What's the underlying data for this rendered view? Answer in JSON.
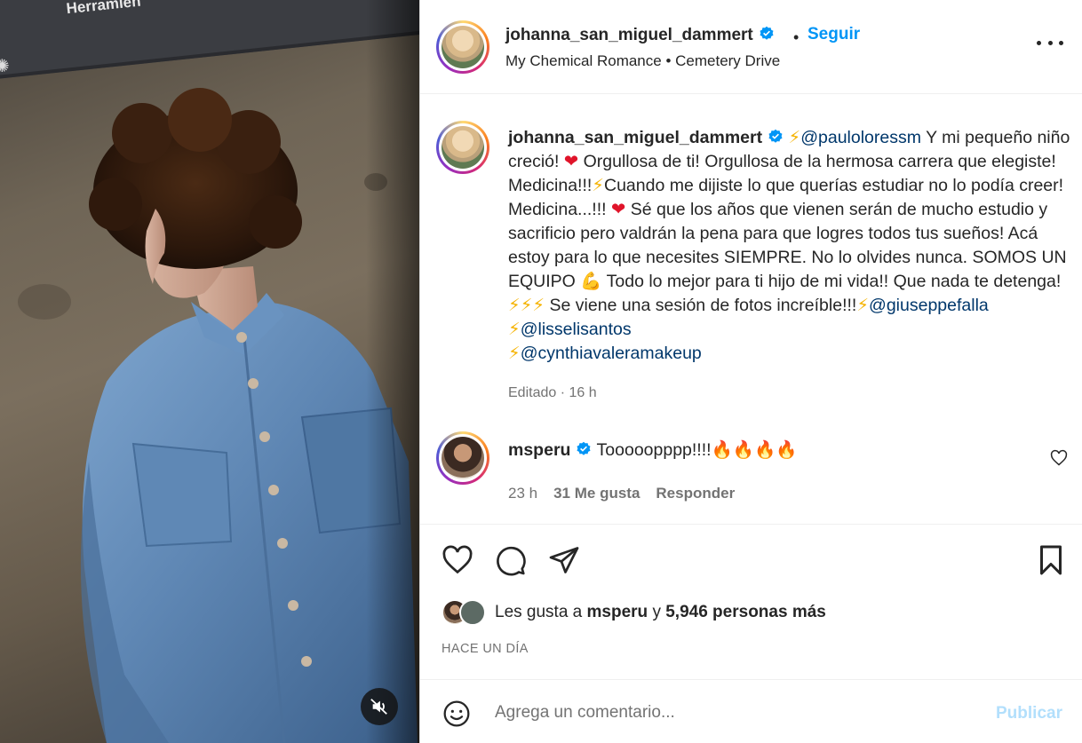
{
  "media": {
    "screen_tab_text": "Herramien",
    "mute_icon": "speaker-muted-icon"
  },
  "header": {
    "username": "johanna_san_miguel_dammert",
    "separator": "•",
    "follow_label": "Seguir",
    "song": "My Chemical Romance • Cemetery Drive"
  },
  "caption": {
    "username": "johanna_san_miguel_dammert",
    "mention_1": "@pauloloressm",
    "text_1": " Y mi pequeño niño creció! ",
    "text_2": " Orgullosa de ti! Orgullosa de la hermosa carrera que elegiste! Medicina!!!",
    "text_3": "Cuando me dijiste lo que querías estudiar no lo podía creer! Medicina...!!! ",
    "text_4": "  Sé que los años que vienen serán de mucho estudio y sacrificio pero valdrán la pena para que logres todos tus sueños! Acá estoy para lo que necesites SIEMPRE. No lo olvides nunca. SOMOS UN EQUIPO ",
    "text_5": " Todo lo mejor para ti hijo de mi vida!! Que nada te detenga! ",
    "text_6": " Se viene una sesión de fotos increíble!!!",
    "mention_2": "@giuseppefalla",
    "mention_3": "@lisselisantos",
    "mention_4": "@cynthiavaleramakeup",
    "emoji_bolt": "⚡",
    "emoji_heart": "❤",
    "emoji_muscle": "💪",
    "meta": "Editado · 16 h"
  },
  "comment": {
    "username": "msperu",
    "text": "Tooooopppp!!!!🔥🔥🔥🔥",
    "time": "23 h",
    "likes": "31 Me gusta",
    "reply": "Responder"
  },
  "likes": {
    "prefix": "Les gusta a ",
    "user": "msperu",
    "connector": " y ",
    "count": "5,946 personas más"
  },
  "time_ago": "HACE UN DÍA",
  "comment_bar": {
    "placeholder": "Agrega un comentario...",
    "publish_label": "Publicar"
  },
  "colors": {
    "link_blue": "#0095f6",
    "mention_blue": "#00376b",
    "muted_text": "#737373",
    "publish_disabled": "#b2dffc"
  }
}
